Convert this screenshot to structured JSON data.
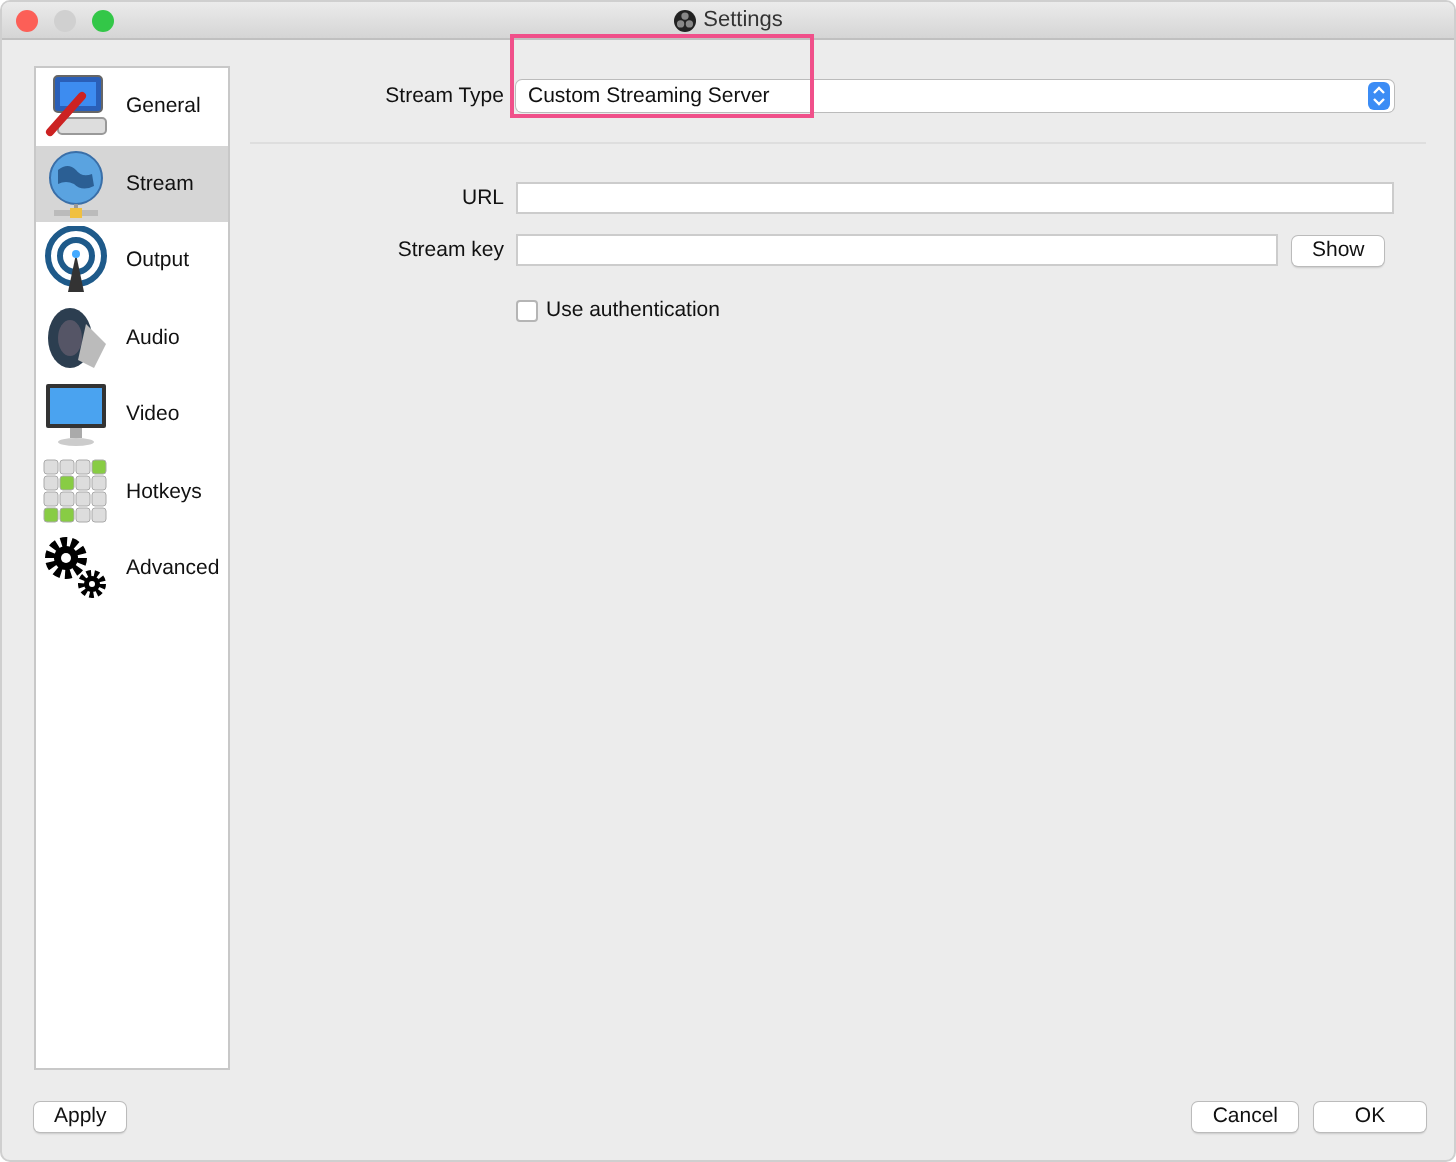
{
  "window": {
    "title": "Settings"
  },
  "sidebar": {
    "items": [
      {
        "label": "General",
        "selected": false
      },
      {
        "label": "Stream",
        "selected": true
      },
      {
        "label": "Output",
        "selected": false
      },
      {
        "label": "Audio",
        "selected": false
      },
      {
        "label": "Video",
        "selected": false
      },
      {
        "label": "Hotkeys",
        "selected": false
      },
      {
        "label": "Advanced",
        "selected": false
      }
    ]
  },
  "stream_type": {
    "label": "Stream Type",
    "value": "Custom Streaming Server",
    "highlighted": true
  },
  "url": {
    "label": "URL"
  },
  "stream_key": {
    "label": "Stream key",
    "button": "Show"
  },
  "use_authentication": {
    "label": "Use authentication",
    "checked": false
  },
  "buttons": {
    "apply": "Apply",
    "cancel": "Cancel",
    "ok": "OK"
  }
}
